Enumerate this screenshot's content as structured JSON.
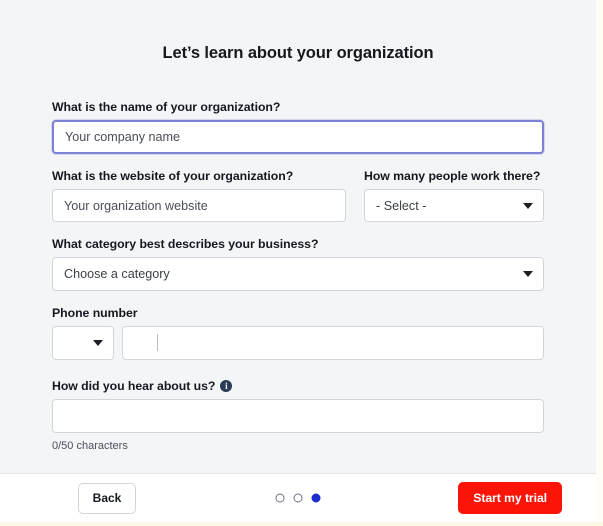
{
  "page": {
    "title": "Let’s learn about your organization",
    "background_color": "#f4f5f7"
  },
  "form": {
    "org_name": {
      "label": "What is the name of your organization?",
      "placeholder": "Your company name",
      "value": "",
      "focused": true
    },
    "org_website": {
      "label": "What is the website of your organization?",
      "placeholder": "Your organization website",
      "value": ""
    },
    "headcount": {
      "label": "How many people work there?",
      "selected": "- Select -",
      "chevron_icon": "chevron-down-icon"
    },
    "category": {
      "label": "What category best describes your business?",
      "selected": "Choose a category",
      "chevron_icon": "chevron-down-icon"
    },
    "phone": {
      "label": "Phone number",
      "country_selected": "",
      "country_chevron_icon": "chevron-down-icon",
      "number_placeholder": "",
      "number_value": ""
    },
    "referral": {
      "label": "How did you hear about us?",
      "info_icon": "info-icon",
      "info_glyph": "i",
      "placeholder": "",
      "value": "",
      "char_count": "0/50 characters"
    }
  },
  "footer": {
    "back_label": "Back",
    "primary_label": "Start my trial",
    "primary_color": "#fc1407",
    "steps": {
      "total": 3,
      "current": 3,
      "active_color": "#1d2fd0"
    }
  }
}
